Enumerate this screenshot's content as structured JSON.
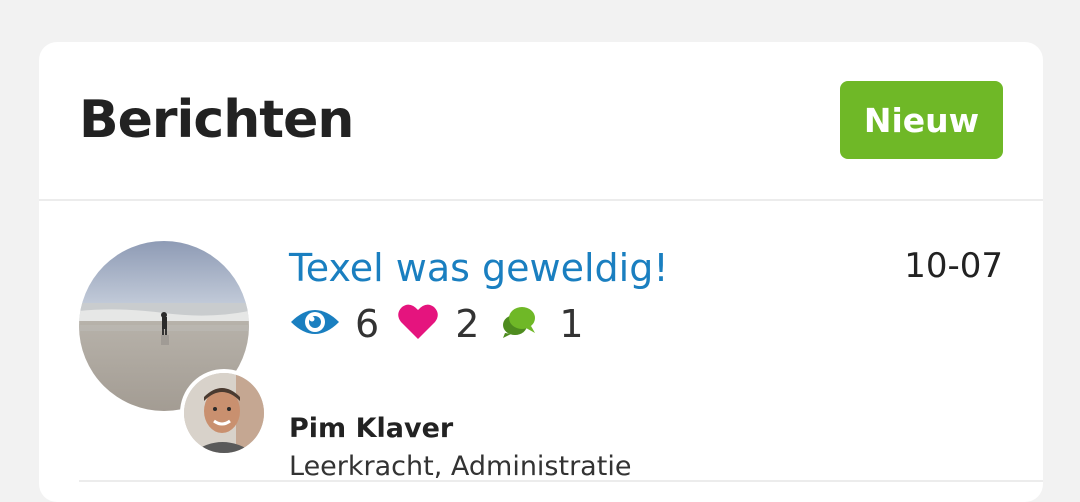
{
  "header": {
    "title": "Berichten",
    "new_button_label": "Nieuw"
  },
  "post": {
    "title": "Texel was geweldig!",
    "date": "10-07",
    "stats": {
      "views": "6",
      "likes": "2",
      "comments": "1"
    },
    "author": {
      "name": "Pim Klaver",
      "role": "Leerkracht, Administratie"
    }
  },
  "colors": {
    "accent_green": "#6fb827",
    "link_blue": "#1a7fc0",
    "heart_pink": "#e5147e"
  },
  "icons": [
    "eye-icon",
    "heart-icon",
    "chat-bubbles-icon"
  ]
}
